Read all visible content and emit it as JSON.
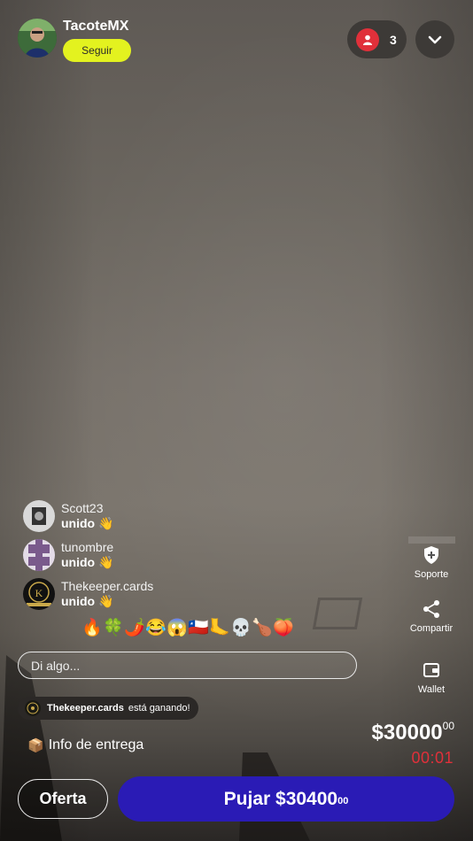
{
  "host": {
    "name": "TacoteMX",
    "follow_label": "Seguir"
  },
  "viewers": {
    "count": "3",
    "icon": "user-icon"
  },
  "events": [
    {
      "name": "Scott23",
      "status": "unido 👋"
    },
    {
      "name": "tunombre",
      "status": "unido 👋"
    },
    {
      "name": "Thekeeper.cards",
      "status": "unido 👋"
    }
  ],
  "reactions": [
    "🔥",
    "🍀",
    "🌶️",
    "😂",
    "😱",
    "🇨🇱",
    "🦶",
    "💀",
    "🍗",
    "🍑"
  ],
  "chat": {
    "placeholder": "Di algo..."
  },
  "winner": {
    "name": "Thekeeper.cards",
    "message": "está ganando!"
  },
  "delivery": {
    "icon": "📦",
    "label": "Info de entrega"
  },
  "auction": {
    "price": "$30000",
    "price_cents": "00",
    "timer": "00:01"
  },
  "side_actions": {
    "support": "Soporte",
    "share": "Compartir",
    "wallet": "Wallet"
  },
  "buttons": {
    "offer": "Oferta",
    "bid": "Pujar $30400",
    "bid_cents": "00"
  },
  "colors": {
    "follow": "#e3f21f",
    "bid": "#2a1bb5",
    "timer": "#e0303a",
    "viewer_badge": "#e0303a"
  }
}
